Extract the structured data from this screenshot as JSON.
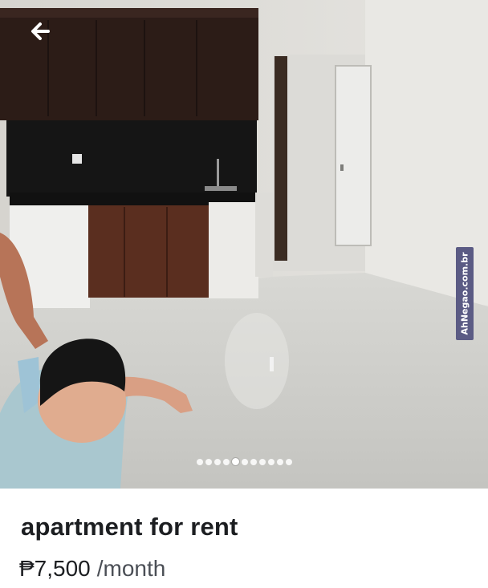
{
  "photo": {
    "back_icon": "arrow-left-icon",
    "watermark": "AhNegao.com.br",
    "dot_count": 11,
    "active_index": 4
  },
  "listing": {
    "title": "apartment for rent",
    "price": "₱7,500",
    "period": "/month"
  }
}
